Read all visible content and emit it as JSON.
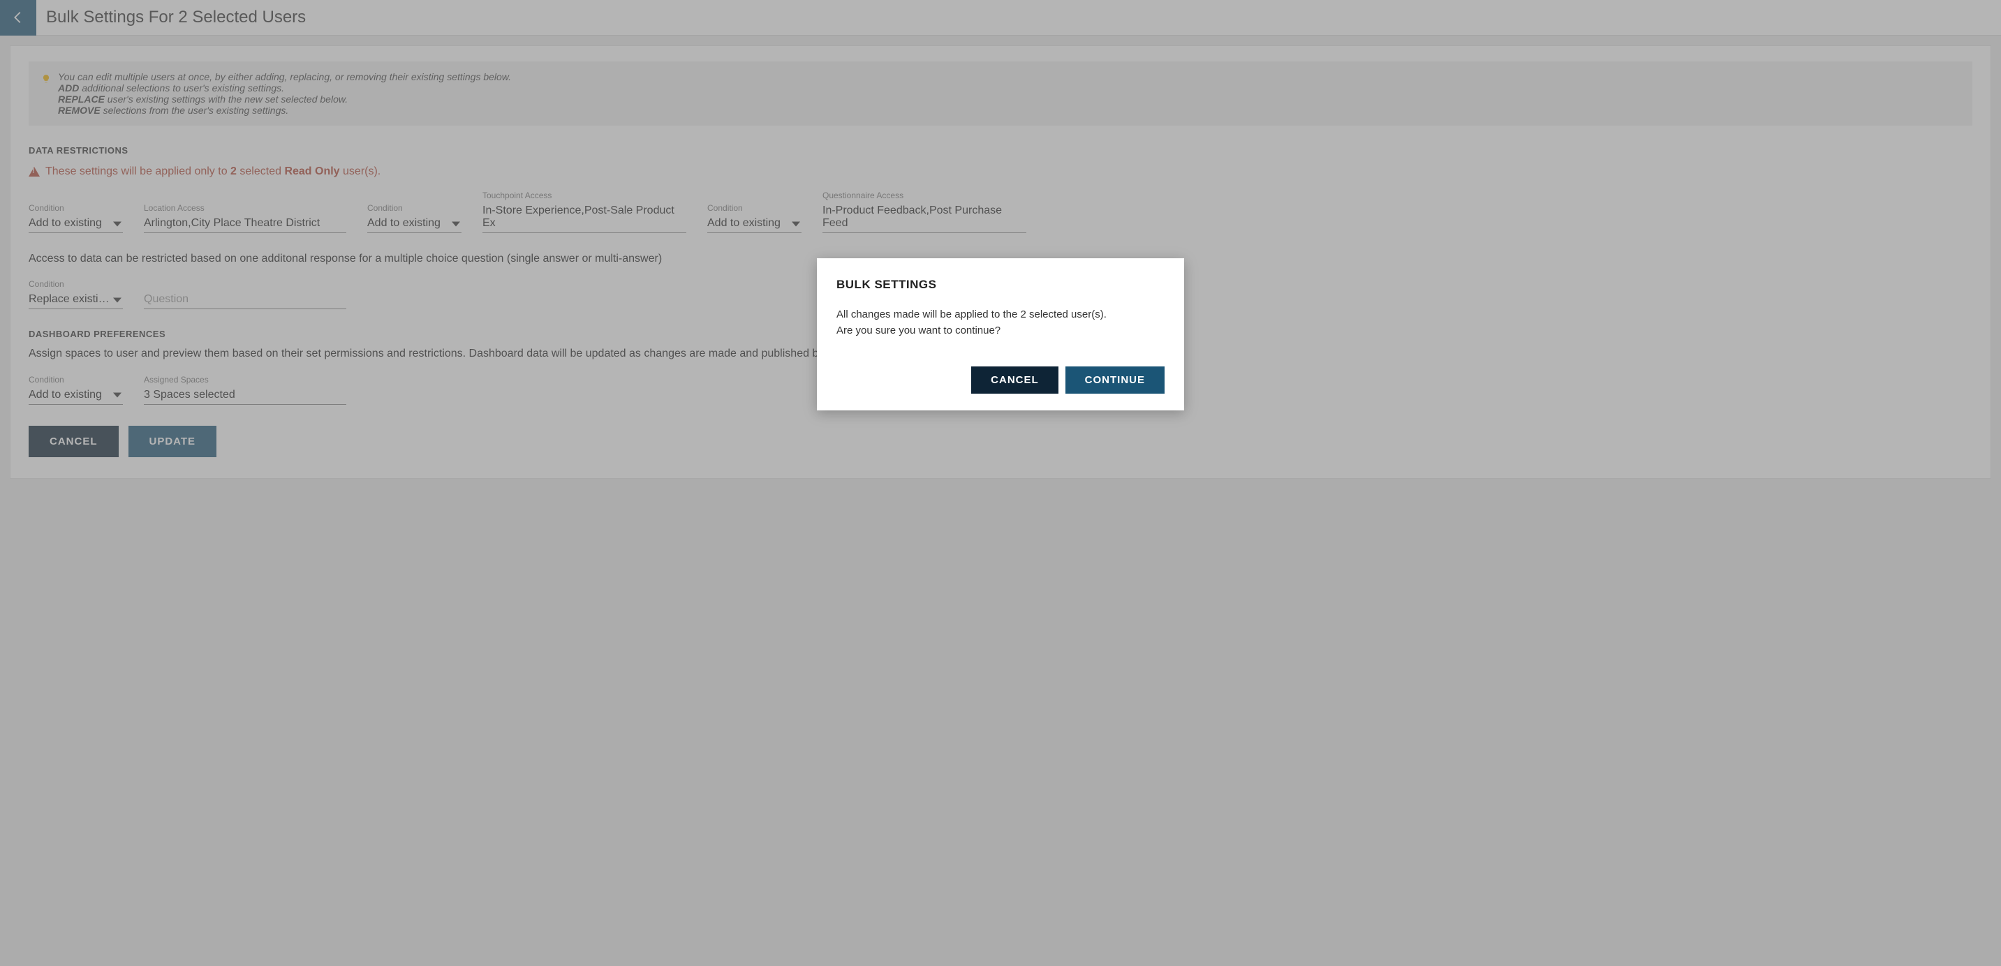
{
  "header": {
    "title": "Bulk Settings For 2 Selected Users"
  },
  "tip": {
    "line1": "You can edit multiple users at once, by either adding, replacing, or removing their existing settings below.",
    "add_label": "ADD",
    "add_text": " additional selections to user's existing settings.",
    "replace_label": "REPLACE",
    "replace_text": " user's existing settings with the new set selected below.",
    "remove_label": "REMOVE",
    "remove_text": " selections from the user's existing settings."
  },
  "data_restrictions": {
    "header": "DATA RESTRICTIONS",
    "warn_prefix": "These settings will be applied only to ",
    "warn_count": "2",
    "warn_mid": " selected ",
    "warn_role": "Read Only",
    "warn_suffix": " user(s).",
    "row1": {
      "cond1_label": "Condition",
      "cond1_value": "Add to existing",
      "loc_label": "Location Access",
      "loc_value": "Arlington,City Place Theatre District",
      "cond2_label": "Condition",
      "cond2_value": "Add to existing",
      "touch_label": "Touchpoint Access",
      "touch_value": "In-Store Experience,Post-Sale Product Ex",
      "cond3_label": "Condition",
      "cond3_value": "Add to existing",
      "quest_label": "Questionnaire Access",
      "quest_value": "In-Product Feedback,Post Purchase Feed"
    },
    "desc1": "Access to data can be restricted based on one additonal response for a multiple choice question (single answer or multi-answer)",
    "row2": {
      "cond_label": "Condition",
      "cond_value": "Replace existi…",
      "question_placeholder": "Question"
    }
  },
  "dashboard": {
    "header": "DASHBOARD PREFERENCES",
    "desc": "Assign spaces to user and preview them based on their set permissions and restrictions. Dashboard data will be updated as changes are made and published by the administrator or users with read & write access to these spaces",
    "cond_label": "Condition",
    "cond_value": "Add to existing",
    "spaces_label": "Assigned Spaces",
    "spaces_value": "3 Spaces selected"
  },
  "buttons": {
    "cancel": "CANCEL",
    "update": "UPDATE"
  },
  "modal": {
    "title": "BULK SETTINGS",
    "body_line1": "All changes made will be applied to the 2 selected user(s).",
    "body_line2": "Are you sure you want to continue?",
    "cancel": "CANCEL",
    "continue": "CONTINUE"
  }
}
